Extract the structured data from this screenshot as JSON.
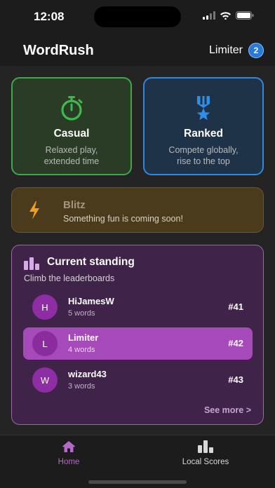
{
  "status_bar": {
    "time": "12:08"
  },
  "header": {
    "app_title": "WordRush",
    "user_name": "Limiter",
    "badge_count": "2"
  },
  "modes": {
    "casual": {
      "title": "Casual",
      "subtitle_line1": "Relaxed play,",
      "subtitle_line2": "extended time",
      "icon": "stopwatch-icon"
    },
    "ranked": {
      "title": "Ranked",
      "subtitle_line1": "Compete globally,",
      "subtitle_line2": "rise to the top",
      "icon": "medal-icon"
    }
  },
  "blitz": {
    "title": "Blitz",
    "subtitle": "Something fun is coming soon!",
    "icon": "lightning-icon"
  },
  "standing": {
    "title": "Current standing",
    "subtitle": "Climb the leaderboards",
    "rows": [
      {
        "initial": "H",
        "name": "HiJamesW",
        "words": "5 words",
        "rank": "#41"
      },
      {
        "initial": "L",
        "name": "Limiter",
        "words": "4 words",
        "rank": "#42"
      },
      {
        "initial": "W",
        "name": "wizard43",
        "words": "3 words",
        "rank": "#43"
      }
    ],
    "see_more": "See more >"
  },
  "tabs": [
    {
      "label": "Home",
      "icon": "house-icon"
    },
    {
      "label": "Local Scores",
      "icon": "bar-chart-icon"
    }
  ],
  "colors": {
    "casual_accent": "#3ea84c",
    "ranked_accent": "#2e8ae0",
    "blitz_accent": "#f0a020",
    "standing_accent": "#a54ab8"
  }
}
